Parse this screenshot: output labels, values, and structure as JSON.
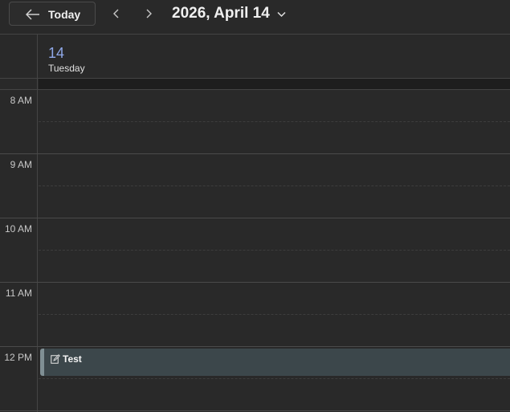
{
  "toolbar": {
    "today_label": "Today",
    "date_title": "2026, April 14"
  },
  "day_header": {
    "day_number": "14",
    "day_name": "Tuesday"
  },
  "hours": [
    "8 AM",
    "9 AM",
    "10 AM",
    "11 AM",
    "12 PM"
  ],
  "event": {
    "title": "Test",
    "icon": "note-edit-icon"
  },
  "colors": {
    "accent_day": "#8fa8e8",
    "event_bg": "#3c474b",
    "event_bar": "#7f8f94",
    "background": "#292929"
  }
}
